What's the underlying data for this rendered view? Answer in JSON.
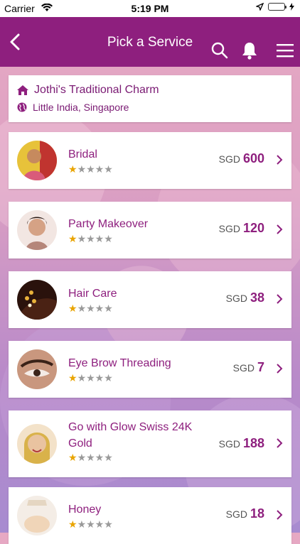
{
  "status": {
    "carrier": "Carrier",
    "time": "5:19 PM"
  },
  "nav": {
    "title": "Pick a Service"
  },
  "shop": {
    "name": "Jothi's Traditional Charm",
    "location": "Little India, Singapore"
  },
  "services": [
    {
      "name": "Bridal",
      "currency": "SGD",
      "price": "600",
      "rating": 1
    },
    {
      "name": "Party Makeover",
      "currency": "SGD",
      "price": "120",
      "rating": 1
    },
    {
      "name": "Hair Care",
      "currency": "SGD",
      "price": "38",
      "rating": 1
    },
    {
      "name": "Eye Brow Threading",
      "currency": "SGD",
      "price": "7",
      "rating": 1
    },
    {
      "name": "Go with Glow Swiss 24K Gold",
      "currency": "SGD",
      "price": "188",
      "rating": 1
    },
    {
      "name": "Honey",
      "currency": "SGD",
      "price": "18",
      "rating": 1
    }
  ],
  "colors": {
    "brand": "#8e1f7e",
    "star": "#e9a400"
  }
}
